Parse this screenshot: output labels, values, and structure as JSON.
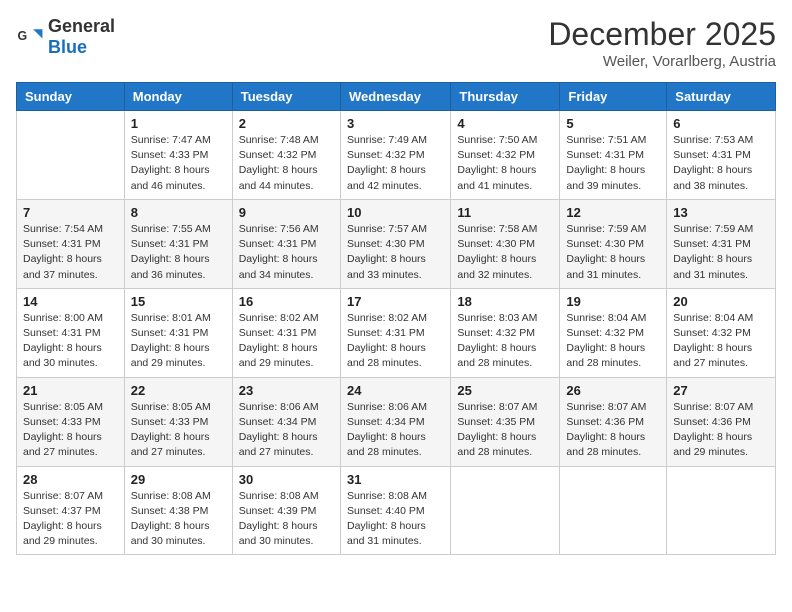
{
  "header": {
    "logo_general": "General",
    "logo_blue": "Blue",
    "month": "December 2025",
    "location": "Weiler, Vorarlberg, Austria"
  },
  "days_of_week": [
    "Sunday",
    "Monday",
    "Tuesday",
    "Wednesday",
    "Thursday",
    "Friday",
    "Saturday"
  ],
  "weeks": [
    [
      {
        "day": "",
        "info": ""
      },
      {
        "day": "1",
        "info": "Sunrise: 7:47 AM\nSunset: 4:33 PM\nDaylight: 8 hours\nand 46 minutes."
      },
      {
        "day": "2",
        "info": "Sunrise: 7:48 AM\nSunset: 4:32 PM\nDaylight: 8 hours\nand 44 minutes."
      },
      {
        "day": "3",
        "info": "Sunrise: 7:49 AM\nSunset: 4:32 PM\nDaylight: 8 hours\nand 42 minutes."
      },
      {
        "day": "4",
        "info": "Sunrise: 7:50 AM\nSunset: 4:32 PM\nDaylight: 8 hours\nand 41 minutes."
      },
      {
        "day": "5",
        "info": "Sunrise: 7:51 AM\nSunset: 4:31 PM\nDaylight: 8 hours\nand 39 minutes."
      },
      {
        "day": "6",
        "info": "Sunrise: 7:53 AM\nSunset: 4:31 PM\nDaylight: 8 hours\nand 38 minutes."
      }
    ],
    [
      {
        "day": "7",
        "info": "Sunrise: 7:54 AM\nSunset: 4:31 PM\nDaylight: 8 hours\nand 37 minutes."
      },
      {
        "day": "8",
        "info": "Sunrise: 7:55 AM\nSunset: 4:31 PM\nDaylight: 8 hours\nand 36 minutes."
      },
      {
        "day": "9",
        "info": "Sunrise: 7:56 AM\nSunset: 4:31 PM\nDaylight: 8 hours\nand 34 minutes."
      },
      {
        "day": "10",
        "info": "Sunrise: 7:57 AM\nSunset: 4:30 PM\nDaylight: 8 hours\nand 33 minutes."
      },
      {
        "day": "11",
        "info": "Sunrise: 7:58 AM\nSunset: 4:30 PM\nDaylight: 8 hours\nand 32 minutes."
      },
      {
        "day": "12",
        "info": "Sunrise: 7:59 AM\nSunset: 4:30 PM\nDaylight: 8 hours\nand 31 minutes."
      },
      {
        "day": "13",
        "info": "Sunrise: 7:59 AM\nSunset: 4:31 PM\nDaylight: 8 hours\nand 31 minutes."
      }
    ],
    [
      {
        "day": "14",
        "info": "Sunrise: 8:00 AM\nSunset: 4:31 PM\nDaylight: 8 hours\nand 30 minutes."
      },
      {
        "day": "15",
        "info": "Sunrise: 8:01 AM\nSunset: 4:31 PM\nDaylight: 8 hours\nand 29 minutes."
      },
      {
        "day": "16",
        "info": "Sunrise: 8:02 AM\nSunset: 4:31 PM\nDaylight: 8 hours\nand 29 minutes."
      },
      {
        "day": "17",
        "info": "Sunrise: 8:02 AM\nSunset: 4:31 PM\nDaylight: 8 hours\nand 28 minutes."
      },
      {
        "day": "18",
        "info": "Sunrise: 8:03 AM\nSunset: 4:32 PM\nDaylight: 8 hours\nand 28 minutes."
      },
      {
        "day": "19",
        "info": "Sunrise: 8:04 AM\nSunset: 4:32 PM\nDaylight: 8 hours\nand 28 minutes."
      },
      {
        "day": "20",
        "info": "Sunrise: 8:04 AM\nSunset: 4:32 PM\nDaylight: 8 hours\nand 27 minutes."
      }
    ],
    [
      {
        "day": "21",
        "info": "Sunrise: 8:05 AM\nSunset: 4:33 PM\nDaylight: 8 hours\nand 27 minutes."
      },
      {
        "day": "22",
        "info": "Sunrise: 8:05 AM\nSunset: 4:33 PM\nDaylight: 8 hours\nand 27 minutes."
      },
      {
        "day": "23",
        "info": "Sunrise: 8:06 AM\nSunset: 4:34 PM\nDaylight: 8 hours\nand 27 minutes."
      },
      {
        "day": "24",
        "info": "Sunrise: 8:06 AM\nSunset: 4:34 PM\nDaylight: 8 hours\nand 28 minutes."
      },
      {
        "day": "25",
        "info": "Sunrise: 8:07 AM\nSunset: 4:35 PM\nDaylight: 8 hours\nand 28 minutes."
      },
      {
        "day": "26",
        "info": "Sunrise: 8:07 AM\nSunset: 4:36 PM\nDaylight: 8 hours\nand 28 minutes."
      },
      {
        "day": "27",
        "info": "Sunrise: 8:07 AM\nSunset: 4:36 PM\nDaylight: 8 hours\nand 29 minutes."
      }
    ],
    [
      {
        "day": "28",
        "info": "Sunrise: 8:07 AM\nSunset: 4:37 PM\nDaylight: 8 hours\nand 29 minutes."
      },
      {
        "day": "29",
        "info": "Sunrise: 8:08 AM\nSunset: 4:38 PM\nDaylight: 8 hours\nand 30 minutes."
      },
      {
        "day": "30",
        "info": "Sunrise: 8:08 AM\nSunset: 4:39 PM\nDaylight: 8 hours\nand 30 minutes."
      },
      {
        "day": "31",
        "info": "Sunrise: 8:08 AM\nSunset: 4:40 PM\nDaylight: 8 hours\nand 31 minutes."
      },
      {
        "day": "",
        "info": ""
      },
      {
        "day": "",
        "info": ""
      },
      {
        "day": "",
        "info": ""
      }
    ]
  ]
}
